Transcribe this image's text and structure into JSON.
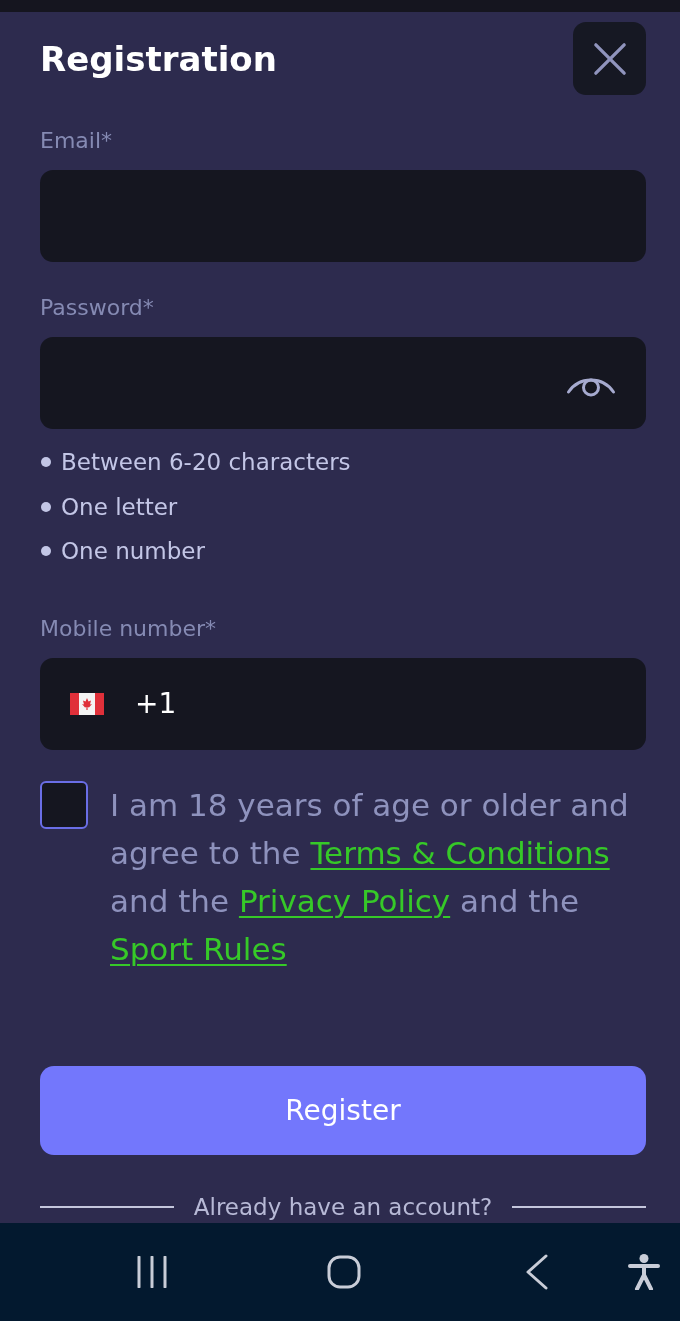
{
  "title": "Registration",
  "fields": [
    {
      "kind": "email",
      "label": "Email*"
    },
    {
      "kind": "password",
      "label": "Password*",
      "rules": [
        "Between 6-20 characters",
        "One letter",
        "One number"
      ]
    },
    {
      "kind": "phone",
      "label": "Mobile number*",
      "prefix": "+1"
    }
  ],
  "agreement": {
    "checked": false,
    "parts": [
      {
        "kind": "text",
        "text": "I am 18 years of age or older and agree to the "
      },
      {
        "kind": "link",
        "text": "Terms & Conditions"
      },
      {
        "kind": "text",
        "text": " and the "
      },
      {
        "kind": "link",
        "text": "Privacy Policy"
      },
      {
        "kind": "text",
        "text": " and the "
      },
      {
        "kind": "link",
        "text": "Sport Rules"
      }
    ]
  },
  "register_button": "Register",
  "login_prompt": "Already have an account?"
}
